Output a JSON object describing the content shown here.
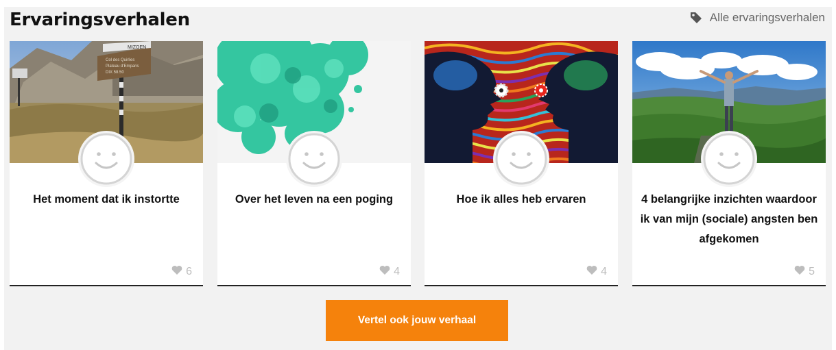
{
  "header": {
    "title": "Ervaringsverhalen",
    "all_link": {
      "label": "Alle ervaringsverhalen",
      "icon": "tag-icon"
    }
  },
  "cards": [
    {
      "title": "Het moment dat ik instortte",
      "likes": "6",
      "image": "mountain-signpost",
      "image_sign_text": [
        "MIZOEN",
        "Col des Quirlies",
        "Plateau d'Emparis",
        "DIX 58.50"
      ]
    },
    {
      "title": "Over het leven na een poging",
      "likes": "4",
      "image": "turquoise-ink-cloud"
    },
    {
      "title": "Hoe ik alles heb ervaren",
      "likes": "4",
      "image": "psychedelic-faces"
    },
    {
      "title": "4 belangrijke inzichten waardoor ik van mijn (sociale) angsten ben afgekomen",
      "likes": "5",
      "image": "man-arms-wide-landscape"
    }
  ],
  "cta": {
    "label": "Vertel ook jouw verhaal"
  },
  "colors": {
    "accent": "#f5820c",
    "background": "#f2f2f2",
    "like": "#bdbdbd"
  },
  "icons": {
    "avatar": "smiley-avatar-icon",
    "like": "heart-icon"
  }
}
